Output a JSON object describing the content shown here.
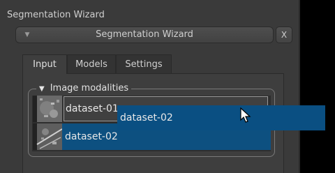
{
  "panel": {
    "title": "Segmentation Wizard"
  },
  "collapsible": {
    "label": "Segmentation Wizard",
    "arrow": "▼",
    "close_label": "X"
  },
  "tabs": [
    {
      "label": "Input",
      "active": true
    },
    {
      "label": "Models",
      "active": false
    },
    {
      "label": "Settings",
      "active": false
    }
  ],
  "group": {
    "title": "Image modalities",
    "arrow": "▼"
  },
  "modalities": [
    {
      "name": "dataset-01",
      "editing": true
    },
    {
      "name": "dataset-02",
      "selected": true
    }
  ],
  "drag": {
    "label": "dataset-02"
  },
  "icons": {
    "collapse": "triangle-down-icon",
    "cursor": "mouse-pointer-icon"
  },
  "colors": {
    "selection": "#0d5080",
    "panel": "#3a3a3a",
    "background": "#000000"
  }
}
